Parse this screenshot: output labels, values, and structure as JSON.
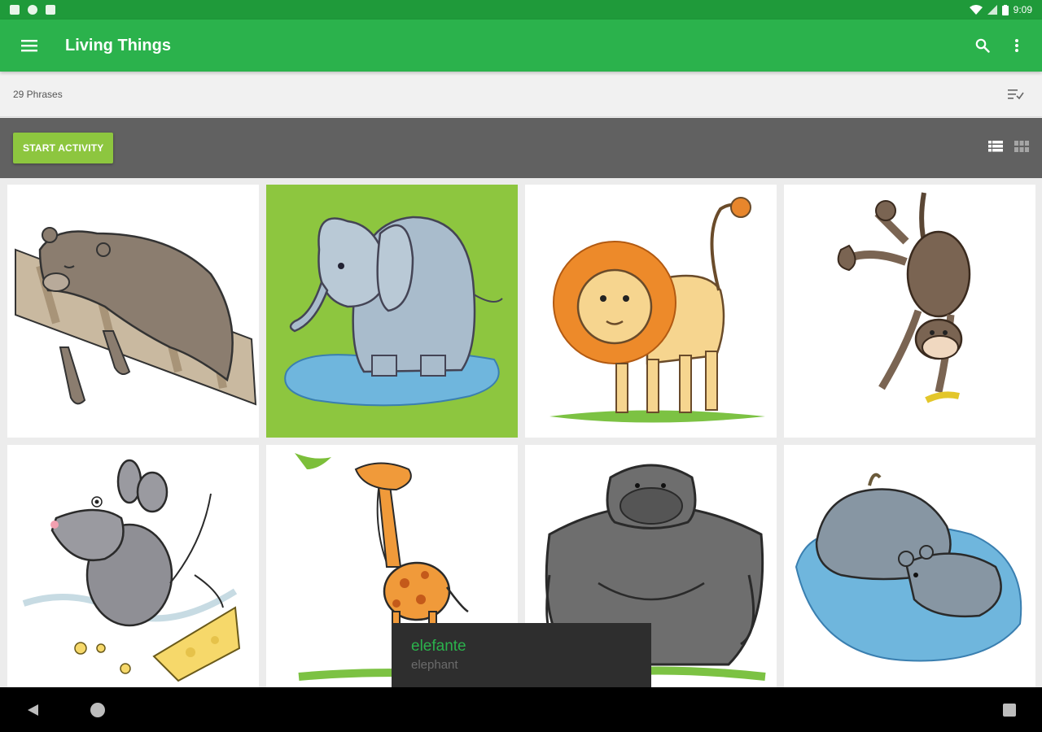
{
  "status": {
    "time": "9:09"
  },
  "app_bar": {
    "title": "Living Things",
    "icons": [
      "menu-icon",
      "search-icon",
      "more-vert-icon"
    ]
  },
  "sub_bar": {
    "phrase_count": "29 Phrases",
    "icons": [
      "sort-check-icon"
    ]
  },
  "action_bar": {
    "start_label": "START ACTIVITY",
    "icons": [
      "list-view-icon",
      "grid-view-icon"
    ]
  },
  "cards": [
    {
      "animal": "bear",
      "selected": false
    },
    {
      "animal": "elephant",
      "selected": true
    },
    {
      "animal": "lion",
      "selected": false
    },
    {
      "animal": "monkey",
      "selected": false
    },
    {
      "animal": "mouse",
      "selected": false
    },
    {
      "animal": "giraffe",
      "selected": false
    },
    {
      "animal": "gorilla",
      "selected": false
    },
    {
      "animal": "hippo",
      "selected": false
    }
  ],
  "toast": {
    "word": "elefante",
    "translation": "elephant"
  },
  "colors": {
    "status_bar": "#1f9a3a",
    "app_bar": "#2bb24c",
    "accent_green": "#8dc63f",
    "action_bar": "#616161",
    "toast_bg": "#2e2e2e"
  }
}
